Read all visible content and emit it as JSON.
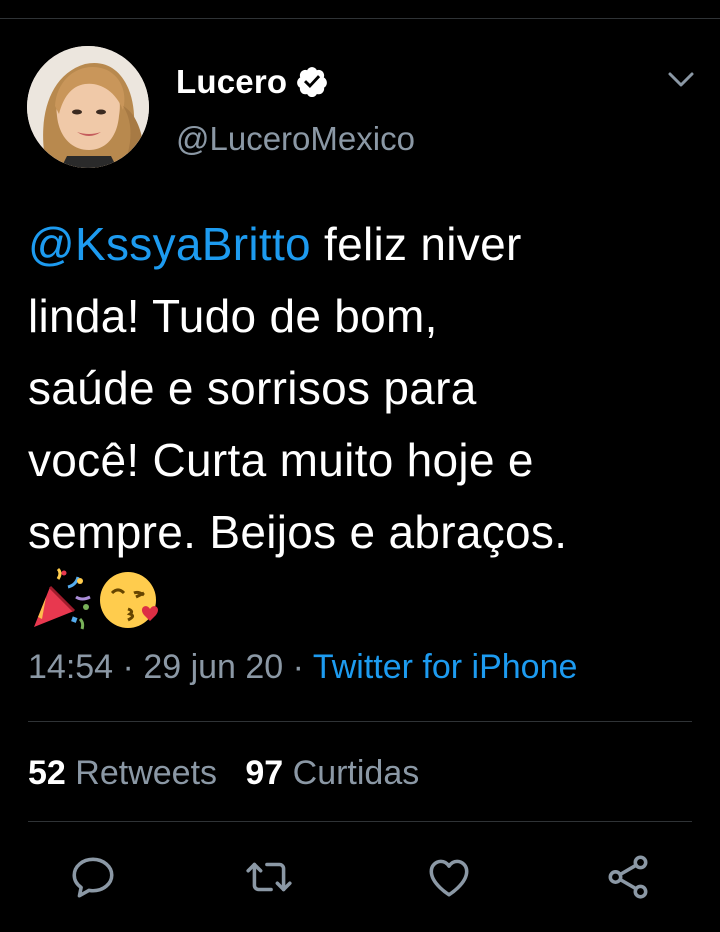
{
  "tweet": {
    "author_name": "Lucero",
    "handle": "@LuceroMexico",
    "mention": "@KssyaBritto",
    "line1_rest": " feliz niver",
    "line2": "linda! Tudo de bom,",
    "line3": "saúde e sorrisos para",
    "line4": "você! Curta muito hoje e",
    "line5": "sempre. Beijos e abraços.",
    "emojis": [
      "party-popper-icon",
      "kissing-face-heart-icon"
    ],
    "time": "14:54",
    "dot1": " · ",
    "date": "29 jun 20",
    "dot2": " · ",
    "source": "Twitter for iPhone"
  },
  "stats": {
    "retweets_count": "52",
    "retweets_label": "Retweets",
    "likes_count": "97",
    "likes_label": "Curtidas"
  },
  "actions": [
    "reply-icon",
    "retweet-icon",
    "like-icon",
    "share-icon"
  ],
  "colors": {
    "background": "#000000",
    "link": "#1d9bf0",
    "muted": "#8b98a5",
    "divider": "#2f3336"
  }
}
